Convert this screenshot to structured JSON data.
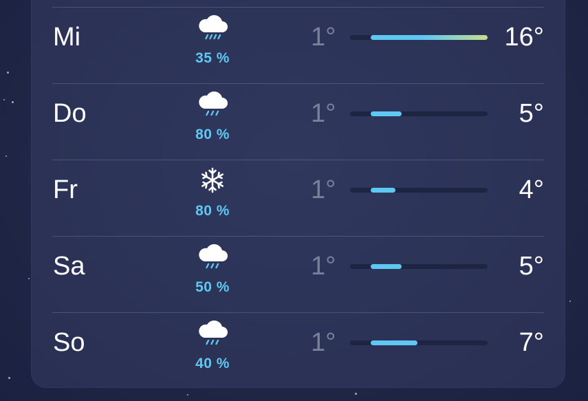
{
  "scale": {
    "min": 1,
    "max": 16
  },
  "days": [
    {
      "day": "Mi",
      "icon": "rain-cloud-icon",
      "precip": "35 %",
      "low_label": "1°",
      "high_label": "16°",
      "low": 1,
      "high": 16
    },
    {
      "day": "Do",
      "icon": "rain-cloud-icon",
      "precip": "80 %",
      "low_label": "1°",
      "high_label": "5°",
      "low": 1,
      "high": 5
    },
    {
      "day": "Fr",
      "icon": "snowflake-icon",
      "precip": "80 %",
      "low_label": "1°",
      "high_label": "4°",
      "low": 1,
      "high": 4
    },
    {
      "day": "Sa",
      "icon": "rain-cloud-icon",
      "precip": "50 %",
      "low_label": "1°",
      "high_label": "5°",
      "low": 1,
      "high": 5
    },
    {
      "day": "So",
      "icon": "rain-cloud-icon",
      "precip": "40 %",
      "low_label": "1°",
      "high_label": "7°",
      "low": 1,
      "high": 7
    }
  ],
  "colors": {
    "bar_cool": "#5fc8f2",
    "bar_warm": "#c8dc8c",
    "precip": "#5fc8f2"
  }
}
